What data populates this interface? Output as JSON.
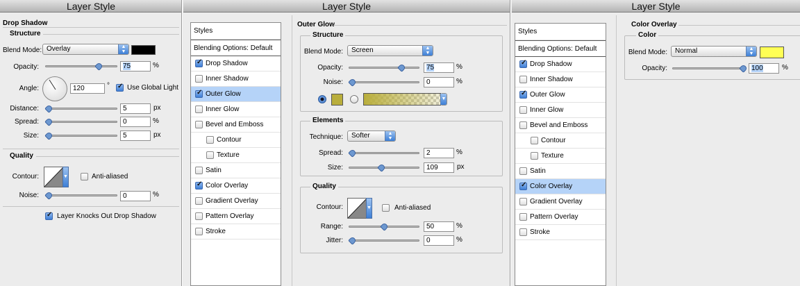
{
  "panels": {
    "drop_shadow": {
      "title": "Layer Style",
      "section": "Drop Shadow",
      "structure_legend": "Structure",
      "blend_mode_label": "Blend Mode:",
      "blend_mode_value": "Overlay",
      "swatch_color": "#000000",
      "opacity_label": "Opacity:",
      "opacity_value": "75",
      "opacity_level": 75,
      "percent": "%",
      "angle_label": "Angle:",
      "angle_value": "120",
      "degree": "°",
      "use_global_light": "Use Global Light",
      "distance_label": "Distance:",
      "distance_value": "5",
      "distance_level": 2,
      "px": "px",
      "spread_label": "Spread:",
      "spread_value": "0",
      "spread_level": 0,
      "size_label": "Size:",
      "size_value": "5",
      "size_level": 2,
      "quality_legend": "Quality",
      "contour_label": "Contour:",
      "anti_aliased": "Anti-aliased",
      "noise_label": "Noise:",
      "noise_value": "0",
      "noise_level": 0,
      "knocks_out": "Layer Knocks Out Drop Shadow"
    },
    "outer_glow": {
      "title": "Layer Style",
      "section": "Outer Glow",
      "structure_legend": "Structure",
      "blend_mode_label": "Blend Mode:",
      "blend_mode_value": "Screen",
      "opacity_label": "Opacity:",
      "opacity_value": "75",
      "opacity_level": 75,
      "noise_label": "Noise:",
      "noise_value": "0",
      "noise_level": 0,
      "percent": "%",
      "glow_color": "#b9ae3c",
      "elements_legend": "Elements",
      "technique_label": "Technique:",
      "technique_value": "Softer",
      "spread_label": "Spread:",
      "spread_value": "2",
      "spread_level": 2,
      "size_label": "Size:",
      "size_value": "109",
      "size_level": 44,
      "px": "px",
      "quality_legend": "Quality",
      "contour_label": "Contour:",
      "anti_aliased": "Anti-aliased",
      "range_label": "Range:",
      "range_value": "50",
      "range_level": 50,
      "jitter_label": "Jitter:",
      "jitter_value": "0",
      "jitter_level": 0
    },
    "color_overlay": {
      "title": "Layer Style",
      "section": "Color Overlay",
      "color_legend": "Color",
      "blend_mode_label": "Blend Mode:",
      "blend_mode_value": "Normal",
      "swatch_color": "#ffff55",
      "opacity_label": "Opacity:",
      "opacity_value": "100",
      "opacity_level": 100,
      "percent": "%"
    }
  },
  "styles_list_a": {
    "header": "Styles",
    "blending": "Blending Options: Default",
    "items": [
      {
        "label": "Drop Shadow",
        "checked": true
      },
      {
        "label": "Inner Shadow",
        "checked": false
      },
      {
        "label": "Outer Glow",
        "checked": true,
        "selected": true
      },
      {
        "label": "Inner Glow",
        "checked": false
      },
      {
        "label": "Bevel and Emboss",
        "checked": false
      },
      {
        "label": "Contour",
        "checked": false
      },
      {
        "label": "Texture",
        "checked": false
      },
      {
        "label": "Satin",
        "checked": false
      },
      {
        "label": "Color Overlay",
        "checked": true
      },
      {
        "label": "Gradient Overlay",
        "checked": false
      },
      {
        "label": "Pattern Overlay",
        "checked": false
      },
      {
        "label": "Stroke",
        "checked": false
      }
    ]
  },
  "styles_list_b": {
    "header": "Styles",
    "blending": "Blending Options: Default",
    "items": [
      {
        "label": "Drop Shadow",
        "checked": true
      },
      {
        "label": "Inner Shadow",
        "checked": false
      },
      {
        "label": "Outer Glow",
        "checked": true
      },
      {
        "label": "Inner Glow",
        "checked": false
      },
      {
        "label": "Bevel and Emboss",
        "checked": false
      },
      {
        "label": "Contour",
        "checked": false
      },
      {
        "label": "Texture",
        "checked": false
      },
      {
        "label": "Satin",
        "checked": false
      },
      {
        "label": "Color Overlay",
        "checked": true,
        "selected": true
      },
      {
        "label": "Gradient Overlay",
        "checked": false
      },
      {
        "label": "Pattern Overlay",
        "checked": false
      },
      {
        "label": "Stroke",
        "checked": false
      }
    ]
  },
  "colors": {
    "selection": "#b5d3f8",
    "accent": "#3d7fd6"
  }
}
